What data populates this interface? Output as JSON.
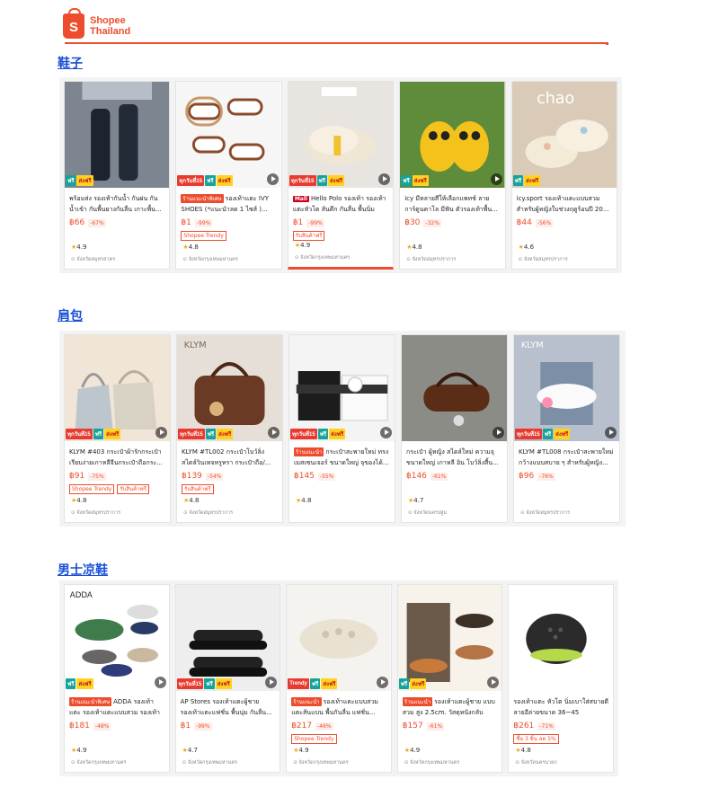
{
  "brand": {
    "line1": "Shopee",
    "line2": "Thailand",
    "logo_letter": "S"
  },
  "sections": [
    {
      "title": "鞋子",
      "products": [
        {
          "tag": "",
          "tag_type": "",
          "title": "พร้อมส่ง รองเท้ากันน้ำ กันฝน กันน้ำเข้า กันพื้นยางกันลื่น เกาะพื้น...",
          "price": "฿66",
          "discount": "-67%",
          "chips": [],
          "rating": "4.9",
          "location": "จังหวัดสมุทรสาคร",
          "badges": [
            "ฟรี",
            "ส่งฟรี"
          ]
        },
        {
          "tag": "ร้านแนะนำพิเศษ",
          "tag_type": "preferred",
          "title": "รองเท้าแตะ IVY SHOES (*แนะนำลด 1 ไซส์ )...",
          "price": "฿1",
          "discount": "-99%",
          "chips": [
            "Shopee Trendy"
          ],
          "rating": "4.8",
          "location": "จังหวัดกรุงเทพมหานคร",
          "badges": [
            "ทุกวันที่15",
            "ฟรี",
            "ส่งฟรี"
          ]
        },
        {
          "tag": "Mall",
          "tag_type": "mall",
          "title": "Hello Polo รองเท้า รองเท้าแตะหัวโต ส้นตึก กันลื่น พื้นนิ่ม สาล...",
          "price": "฿1",
          "discount": "-99%",
          "chips": [
            "รับสินค้าฟรี"
          ],
          "rating": "4.9",
          "location": "จังหวัดกรุงเทพมหานคร",
          "badges": [
            "ทุกวันที่15",
            "ฟรี",
            "ส่งฟรี"
          ]
        },
        {
          "tag": "",
          "tag_type": "",
          "title": "icy มีหลายสีให้เลือกแพทช์ ลายการ์ตูนคาโล มีฟัน ตัวรองเท้าพื้น...",
          "price": "฿30",
          "discount": "-32%",
          "chips": [],
          "rating": "4.8",
          "location": "จังหวัดสมุทรปราการ",
          "badges": [
            "ฟรี",
            "ส่งฟรี"
          ]
        },
        {
          "tag": "",
          "tag_type": "",
          "title": "icy.sport รองเท้าแตะแบบสวม สำหรับผู้หญิงใบช่วงฤดูร้อนปี 20...",
          "price": "฿44",
          "discount": "-56%",
          "chips": [],
          "rating": "4.6",
          "location": "จังหวัดสมุทรปราการ",
          "badges": [
            "ฟรี",
            "ส่งฟรี"
          ]
        }
      ]
    },
    {
      "title": "肩包",
      "products": [
        {
          "tag": "",
          "tag_type": "",
          "title": "KLYM #403 กระเป๋าผ้ารักกระเป๋าเรียบง่ายเกาหลีจีนกระเป๋าถือกระ...",
          "price": "฿91",
          "discount": "-75%",
          "chips": [
            "Shopee Trendy",
            "รับสินค้าฟรี"
          ],
          "rating": "4.8",
          "location": "จังหวัดสมุทรปราการ",
          "badges": [
            "ทุกวันที่15",
            "ฟรี",
            "ส่งฟรี"
          ]
        },
        {
          "tag": "",
          "tag_type": "",
          "title": "KLYM #TL002 กระเป๋าโบว์ลิ่ง สไตล์วินเทจหรูหรา กระเป๋าถือ/...",
          "price": "฿139",
          "discount": "-54%",
          "chips": [
            "รับสินค้าฟรี"
          ],
          "rating": "4.8",
          "location": "จังหวัดสมุทรปราการ",
          "badges": [
            "ทุกวันที่15",
            "ฟรี",
            "ส่งฟรี"
          ]
        },
        {
          "tag": "ร้านแนะนำ",
          "tag_type": "preferred",
          "title": "กระเป๋าสะพายใหม่ ทรงเมสเซนเจอร์ ขนาดใหญ่ จุของได้...",
          "price": "฿145",
          "discount": "-55%",
          "chips": [],
          "rating": "4.8",
          "location": "",
          "badges": [
            "ทุกวันที่15",
            "ฟรี",
            "ส่งฟรี"
          ]
        },
        {
          "tag": "",
          "tag_type": "",
          "title": "กระเป๋า ผู้หญิง สไตล์ใหม่ ความจุขนาดใหญ่ เกาหลี อิน โบว์ลิ่งสี้น...",
          "price": "฿146",
          "discount": "-61%",
          "chips": [],
          "rating": "4.7",
          "location": "จังหวัดนครปฐม",
          "badges": []
        },
        {
          "tag": "",
          "tag_type": "",
          "title": "KLYM #TL008 กระเป๋าสะพายใหม่ กว้างแบบสบาย ๆ สำหรับผู้หญิง...",
          "price": "฿96",
          "discount": "-76%",
          "chips": [],
          "rating": "",
          "location": "จังหวัดสมุทรปราการ",
          "badges": [
            "ทุกวันที่15",
            "ฟรี",
            "ส่งฟรี"
          ]
        }
      ]
    },
    {
      "title": "男士凉鞋",
      "products": [
        {
          "tag": "ร้านแนะนำพิเศษ",
          "tag_type": "preferred",
          "title": "ADDA รองเท้าแตะ รองเท้าแตะแบบสวม รองเท้าหัวโ...",
          "price": "฿181",
          "discount": "-48%",
          "chips": [],
          "rating": "4.9",
          "location": "จังหวัดกรุงเทพมหานคร",
          "badges": [
            "ฟรี",
            "ส่งฟรี"
          ]
        },
        {
          "tag": "",
          "tag_type": "",
          "title": "AP Stores รองเท้าแตะผู้ชาย รองเท้าแตะแฟชั่น พื้นนุ่ม กันลื่น...",
          "price": "฿1",
          "discount": "-99%",
          "chips": [],
          "rating": "4.7",
          "location": "จังหวัดกรุงเทพมหานคร",
          "badges": [
            "ทุกวันที่15",
            "ฟรี",
            "ส่งฟรี"
          ]
        },
        {
          "tag": "ร้านแนะนำ",
          "tag_type": "preferred",
          "title": "รองเท้าแตะแบบสวม แตะส้นแบน พื้นกันลื่น แฟชั่น...",
          "price": "฿217",
          "discount": "-46%",
          "chips": [
            "Shopee Trendy"
          ],
          "rating": "4.9",
          "location": "จังหวัดกรุงเทพมหานคร",
          "badges": [
            "Trendy",
            "ฟรี",
            "ส่งฟรี"
          ]
        },
        {
          "tag": "ร้านแนะนำ",
          "tag_type": "preferred",
          "title": "รองเท้าแตะผู้ชาย แบบสวม สูง 2.5cm. วัสดุหนังกลับ ตัว...",
          "price": "฿157",
          "discount": "-61%",
          "chips": [],
          "rating": "4.9",
          "location": "จังหวัดกรุงเทพมหานคร",
          "badges": [
            "ฟรี",
            "ส่งฟรี"
          ]
        },
        {
          "tag": "",
          "tag_type": "",
          "title": "รองเท้าแตะ หัวโต นิ่มเบาใส่สบายดี ลายอีล่ายขนาด 36~45",
          "price": "฿261",
          "discount": "-71%",
          "chips": [
            "ซื้อ 3 ชิ้น ลด 5%"
          ],
          "rating": "4.8",
          "location": "จังหวัดนครนายก",
          "badges": []
        }
      ]
    }
  ],
  "colors": {
    "accent": "#ee4d2d",
    "link": "#1a4fd6"
  }
}
